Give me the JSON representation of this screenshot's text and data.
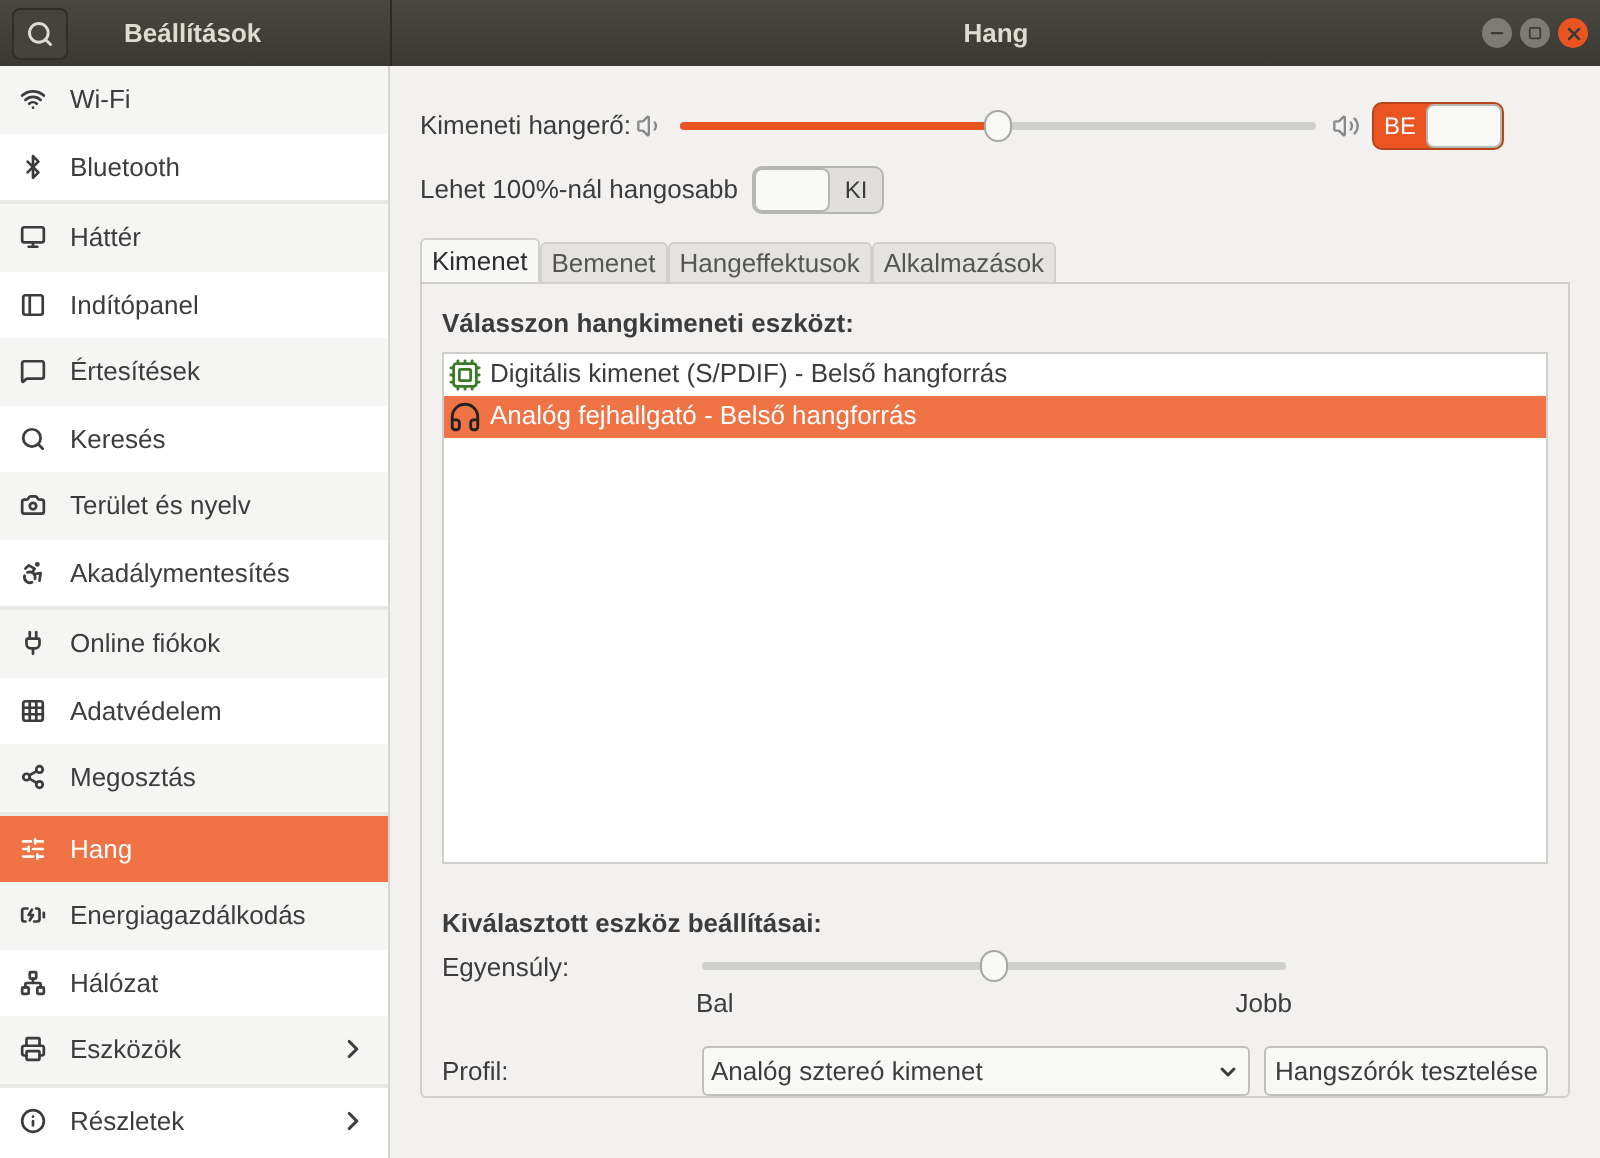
{
  "sidebar": {
    "title": "Beállítások",
    "groups": [
      [
        {
          "label": "Wi-Fi",
          "selected": false,
          "submenu": false
        },
        {
          "label": "Bluetooth",
          "selected": false,
          "submenu": false
        }
      ],
      [
        {
          "label": "Háttér",
          "selected": false,
          "submenu": false
        },
        {
          "label": "Indítópanel",
          "selected": false,
          "submenu": false
        },
        {
          "label": "Értesítések",
          "selected": false,
          "submenu": false
        },
        {
          "label": "Keresés",
          "selected": false,
          "submenu": false
        },
        {
          "label": "Terület és nyelv",
          "selected": false,
          "submenu": false
        },
        {
          "label": "Akadálymentesítés",
          "selected": false,
          "submenu": false
        }
      ],
      [
        {
          "label": "Online fiókok",
          "selected": false,
          "submenu": false
        },
        {
          "label": "Adatvédelem",
          "selected": false,
          "submenu": false
        },
        {
          "label": "Megosztás",
          "selected": false,
          "submenu": false
        }
      ],
      [
        {
          "label": "Hang",
          "selected": true,
          "submenu": false
        },
        {
          "label": "Energiagazdálkodás",
          "selected": false,
          "submenu": false
        },
        {
          "label": "Hálózat",
          "selected": false,
          "submenu": false
        },
        {
          "label": "Eszközök",
          "selected": false,
          "submenu": true
        }
      ],
      [
        {
          "label": "Részletek",
          "selected": false,
          "submenu": true
        }
      ]
    ]
  },
  "window": {
    "title": "Hang"
  },
  "volume": {
    "label": "Kimeneti hangerő:",
    "level": 0.5,
    "switch": {
      "label": "BE",
      "on": true
    }
  },
  "amplify": {
    "label": "Lehet 100%-nál hangosabb",
    "switch": {
      "label": "KI",
      "on": false
    }
  },
  "tabs": [
    {
      "label": "Kimenet",
      "selected": true
    },
    {
      "label": "Bemenet",
      "selected": false
    },
    {
      "label": "Hangeffektusok",
      "selected": false
    },
    {
      "label": "Alkalmazások",
      "selected": false
    }
  ],
  "output": {
    "heading": "Válasszon hangkimeneti eszközt:",
    "devices": [
      {
        "label": "Digitális kimenet (S/PDIF) - Belső hangforrás",
        "kind": "card",
        "selected": false
      },
      {
        "label": "Analóg fejhallgató - Belső hangforrás",
        "kind": "headphones",
        "selected": true
      }
    ]
  },
  "settings": {
    "heading": "Kiválasztott eszköz beállításai:",
    "balance": {
      "label": "Egyensúly:",
      "level": 0.5,
      "left": "Bal",
      "right": "Jobb"
    },
    "profile": {
      "label": "Profil:",
      "value": "Analóg sztereó kimenet",
      "test_button": "Hangszórók tesztelése"
    }
  }
}
